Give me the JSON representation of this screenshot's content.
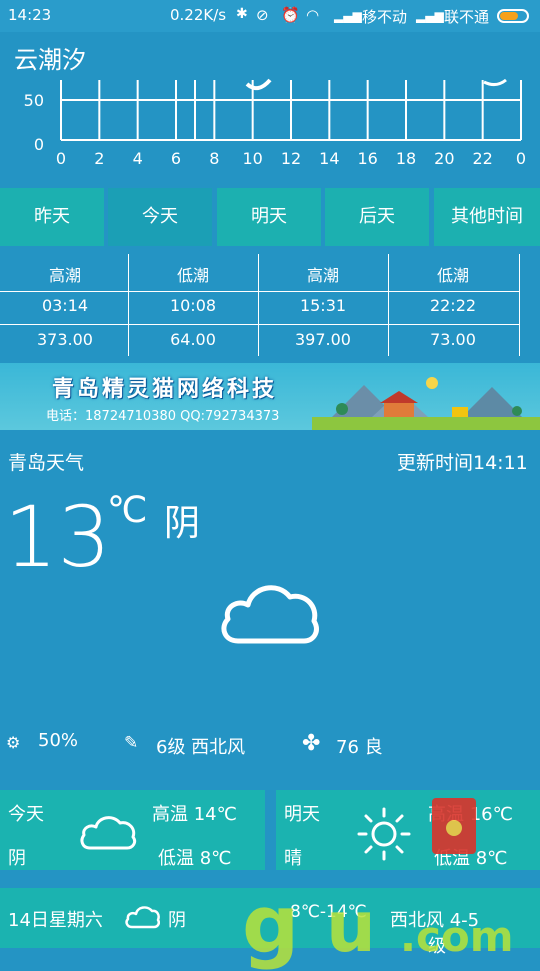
{
  "status_bar": {
    "time": "14:23",
    "speed": "0.22K/s",
    "carrier1": "移不动",
    "carrier2": "联不通"
  },
  "location": "云潮汐",
  "chart": {
    "y_ticks": [
      "50",
      "0"
    ],
    "x_ticks": [
      "0",
      "2",
      "4",
      "6",
      "8",
      "10",
      "12",
      "14",
      "16",
      "18",
      "20",
      "22",
      "0"
    ]
  },
  "tabs": [
    "昨天",
    "今天",
    "明天",
    "后天",
    "其他时间"
  ],
  "active_tab": "今天",
  "tide_table": {
    "headers": [
      "高潮",
      "低潮",
      "高潮",
      "低潮"
    ],
    "times": [
      "03:14",
      "10:08",
      "15:31",
      "22:22"
    ],
    "heights": [
      "373.00",
      "64.00",
      "397.00",
      "73.00"
    ]
  },
  "banner": {
    "title": "青岛精灵猫网络科技",
    "contact": "电话：18724710380 QQ:792734373"
  },
  "weather": {
    "city": "青岛天气",
    "update": "更新时间14:11",
    "temp": "13",
    "unit": "℃",
    "condition": "阴",
    "humidity": "50%",
    "wind": "6级 西北风",
    "aqi": "76 良"
  },
  "today_card": {
    "label": "今天",
    "condition": "阴",
    "high": "高温 14℃",
    "low": "低温 8℃"
  },
  "tomorrow_card": {
    "label": "明天",
    "condition": "晴",
    "high": "高温 16℃",
    "low": "低温 8℃"
  },
  "daily": {
    "date": "14日星期六",
    "condition": "阴",
    "range": "8℃-14℃",
    "wind": "西北风 4-5",
    "wind_unit": "级"
  },
  "watermark": {
    "text1": "g",
    "text2": "u",
    "text3": ".com"
  }
}
